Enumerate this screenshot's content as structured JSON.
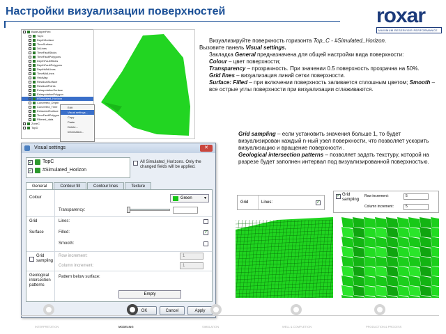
{
  "slide": {
    "title": "Настройки визуализации поверхностей",
    "logo": {
      "word": "roxar",
      "tagline": "MAXIMUM RESERVOIR PERFORMANCE"
    }
  },
  "tree": {
    "items": [
      "BaseUpperFlex",
      "TopC",
      "DepthSurface",
      "TimeSurface",
      "3dLines",
      "TimeFaultSticks",
      "TimeFaultPolygons",
      "DepthFaultSticks",
      "DepthFaultPolygons",
      "DepthMidLines",
      "TimeMidLines",
      "VeloMap",
      "ResidualSurface",
      "ResidualPoints",
      "ExtrapolationSurface",
      "ExtrapolationPolygon",
      "#Simulated_Horizon",
      "Converted_Depth",
      "Converted_Time",
      "ExtractedSurface",
      "TimeFaultPolygon",
      "Filtered_data",
      "ZoneC",
      "TopD"
    ],
    "selected": "#Simulated_Horizon"
  },
  "context_menu": {
    "items": [
      "Edit",
      "Visual settings...",
      "Copy",
      "Paste",
      "Delete...",
      "Information..."
    ],
    "highlighted": "Visual settings..."
  },
  "dialog": {
    "title": "Visual settings",
    "close": "✕",
    "objects": [
      {
        "label": "TopC",
        "checked": true
      },
      {
        "label": "#Simulated_Horizon",
        "checked": true
      }
    ],
    "all_check": {
      "label": "All Simulated_Horizons. Only the changed fields will be applied.",
      "checked": false
    },
    "tabs": [
      "General",
      "Contour fill",
      "Contour lines",
      "Texture"
    ],
    "active_tab": "General",
    "colour_label": "Colour",
    "colour_value": "Green",
    "colour_hex": "#16c416",
    "transparency_label": "Transparency:",
    "grid_label": "Grid",
    "lines_label": "Lines:",
    "lines_checked": false,
    "surface_label": "Surface",
    "filled_label": "Filled:",
    "filled_checked": true,
    "smooth_label": "Smooth:",
    "smooth_checked": false,
    "grid_sampling_label": "Grid sampling",
    "grid_sampling_checked": false,
    "row_increment_label": "Row increment:",
    "row_increment_value": "1",
    "column_increment_label": "Column increment:",
    "column_increment_value": "1",
    "geo_label": "Geological intersection patterns",
    "pattern_label": "Pattern below surface:",
    "pattern_value": "Empty",
    "buttons": {
      "ok": "OK",
      "cancel": "Cancel",
      "apply": "Apply"
    }
  },
  "text": {
    "p1_line1": "Визуализируйте поверхность горизонта",
    "p1_ital1": "Top_C - #Simulated_Horizon",
    "p1_line2": "Вызовите панель",
    "p1_bold2": "Visual settings.",
    "p2_a": "Закладка",
    "p2_bold": "General",
    "p2_b": "предназначена для общей настройки вида поверхности:",
    "p3_bold": "Colour",
    "p3": "– цвет поверхности;",
    "p4_bold": "Transparency",
    "p4": "– прозрачность. При значении 0.5 поверхность прозрачна на 50%.",
    "p5_bold": "Grid lines",
    "p5": "– визуализация линий сетки поверхности.",
    "p6_bold": "Surface: Filled",
    "p6": "– при включении поверхность заливается сплошным цветом;",
    "p6_bold2": "Smooth",
    "p6b": "– все острые углы поверхности при визуализации сглаживаются.",
    "p7_bold": "Grid sampling",
    "p7": "– если установить значения больше 1, то будет визуализирован каждый n-ный узел поверхности, что позволяет ускорить визуализацию и вращение поверхности .",
    "p8_bold": "Geological intersection patterns",
    "p8": "– позволяет задать текстуру, которой на разрезе будет заполнен интервал под визуализированной поверхностью."
  },
  "mini_panels": {
    "left": {
      "grid_label": "Grid",
      "lines_label": "Lines:",
      "lines_checked": true
    },
    "right": {
      "grid_sampling_label": "Grid sampling",
      "row_label": "Row increment:",
      "row_value": "5",
      "col_label": "Column increment:",
      "col_value": "5",
      "checked": true
    }
  },
  "footer": {
    "stages": [
      "INTERPRETATION",
      "MODELING",
      "SIMULATION",
      "WELL & COMPLETION",
      "PRODUCTION & PROCESS"
    ],
    "active": "MODELING"
  }
}
